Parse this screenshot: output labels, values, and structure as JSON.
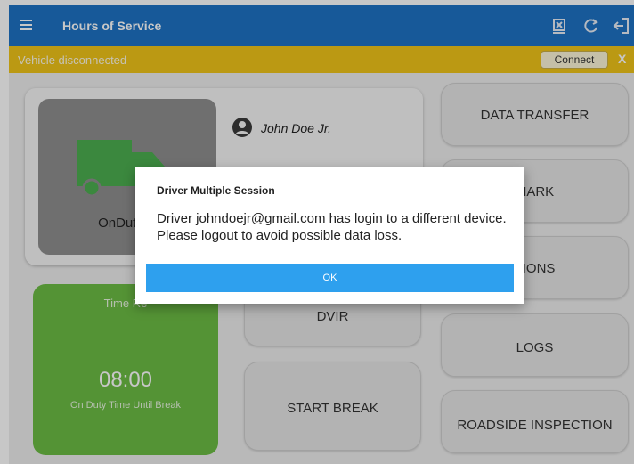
{
  "appbar": {
    "title": "Hours of Service",
    "actions": [
      "data-sync-icon",
      "refresh-icon",
      "logout-icon"
    ]
  },
  "status_bar": {
    "message": "Vehicle disconnected",
    "connect_label": "Connect",
    "close_label": "X"
  },
  "driver": {
    "name": "John Doe Jr.",
    "duty_label": "OnDuty N"
  },
  "buttons": {
    "data_transfer": "DATA TRANSFER",
    "remark": "MARK",
    "options": "TIONS",
    "dvir": "DVIR",
    "logs": "LOGS",
    "start_break": "START BREAK",
    "roadside_inspection": "ROADSIDE INSPECTION"
  },
  "timer": {
    "label": "Time Re",
    "time": "08:00",
    "subtitle": "On Duty Time Until Break"
  },
  "dialog": {
    "title": "Driver Multiple Session",
    "message": "Driver johndoejr@gmail.com has login to a different device. Please logout to avoid possible data loss.",
    "ok_label": "OK"
  },
  "colors": {
    "appbar": "#1e73c4",
    "status_bar": "#f0c419",
    "timer_card": "#6cbd45",
    "truck": "#4caf50",
    "ok_button": "#2ea0ee"
  }
}
